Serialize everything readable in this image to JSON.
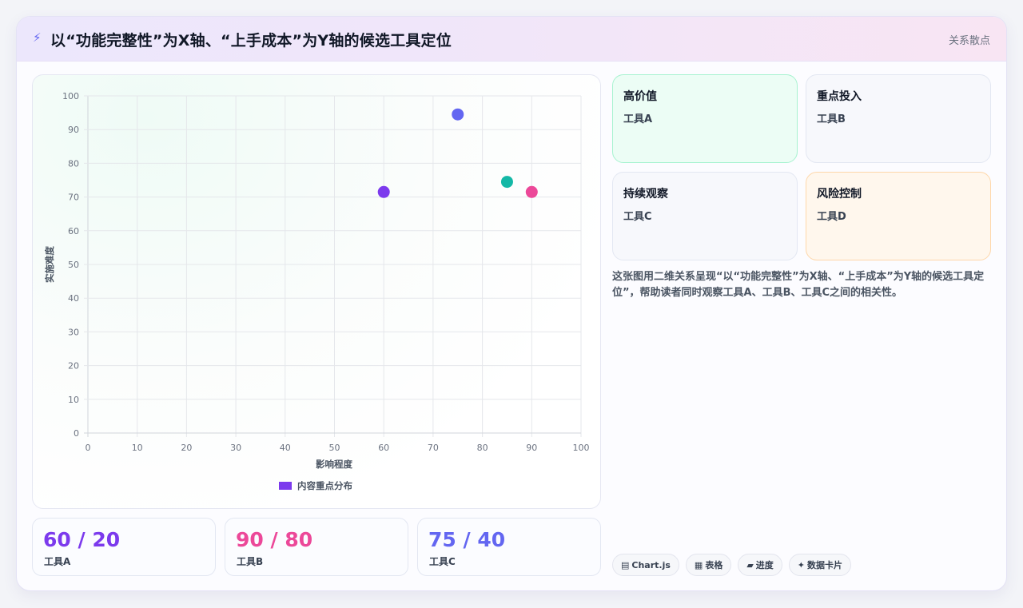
{
  "header": {
    "icon": "bolt-icon",
    "title": "以“功能完整性”为X轴、“上手成本”为Y轴的候选工具定位",
    "tag": "关系散点"
  },
  "chart_data": {
    "type": "scatter",
    "xlabel": "影响程度",
    "ylabel": "实施难度",
    "xlim": [
      0,
      100
    ],
    "ylim": [
      0,
      100
    ],
    "xticks": [
      0,
      10,
      20,
      30,
      40,
      50,
      60,
      70,
      80,
      90,
      100
    ],
    "yticks": [
      0,
      10,
      20,
      30,
      40,
      50,
      60,
      70,
      80,
      90,
      100
    ],
    "grid": true,
    "legend": {
      "position": "bottom",
      "label": "内容重点分布",
      "color": "#7c3aed"
    },
    "points": [
      {
        "x": 60,
        "y": 71.5,
        "color": "#7c3aed"
      },
      {
        "x": 75,
        "y": 94.5,
        "color": "#6366f1"
      },
      {
        "x": 85,
        "y": 74.5,
        "color": "#14b8a6"
      },
      {
        "x": 90,
        "y": 71.5,
        "color": "#ec4899"
      }
    ]
  },
  "stats": [
    {
      "value": "60 / 20",
      "label": "工具A",
      "color": "#7c3aed"
    },
    {
      "value": "90 / 80",
      "label": "工具B",
      "color": "#ec4899"
    },
    {
      "value": "75 / 40",
      "label": "工具C",
      "color": "#6366f1"
    }
  ],
  "quadrants": [
    {
      "title": "高价值",
      "value": "工具A",
      "bg": "#ecfdf5",
      "border": "#a7f3d0"
    },
    {
      "title": "重点投入",
      "value": "工具B",
      "bg": "#f7f8fc",
      "border": "#e3e7f2"
    },
    {
      "title": "持续观察",
      "value": "工具C",
      "bg": "#f7f8fc",
      "border": "#e3e7f2"
    },
    {
      "title": "风险控制",
      "value": "工具D",
      "bg": "#fff7ed",
      "border": "#fed7aa"
    }
  ],
  "description": "这张图用二维关系呈现“以“功能完整性”为X轴、“上手成本”为Y轴的候选工具定位”，帮助读者同时观察工具A、工具B、工具C之间的相关性。",
  "chips": [
    {
      "icon": "▤",
      "icon_name": "chart-icon",
      "label": "Chart.js"
    },
    {
      "icon": "▦",
      "icon_name": "table-icon",
      "label": "表格"
    },
    {
      "icon": "▰",
      "icon_name": "progress-icon",
      "label": "进度"
    },
    {
      "icon": "✦",
      "icon_name": "sparkle-icon",
      "label": "数据卡片"
    }
  ]
}
